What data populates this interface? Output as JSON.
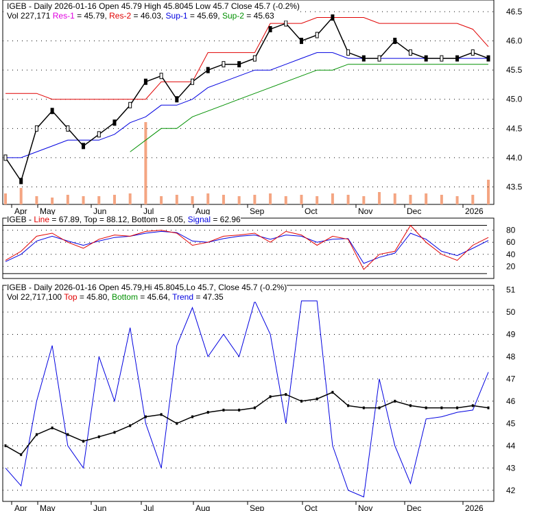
{
  "header1": {
    "line1": "IGEB - Daily 2026-01-16 Open 45.79  High 45.8045  Low 45.7  Close 45.7 (-0.2%)",
    "vol": "Vol 227,171",
    "res1": "Res-1",
    "res1_val": " = 45.79, ",
    "res2": "Res-2",
    "res2_val": " = 46.03, ",
    "sup1": "Sup-1",
    "sup1_val": " = 45.69, ",
    "sup2": "Sup-2",
    "sup2_val": " = 45.63"
  },
  "header2": {
    "prefix": "IGEB - ",
    "line": "Line",
    "line_val": " = 67.89, Top = 88.12, Bottom = 8.05, ",
    "signal": "Signal",
    "signal_val": " = 62.96"
  },
  "header3": {
    "line1": "IGEB - Daily 2026-01-16 Open 45.79,Hi 45.8045,Lo 45.7, Close 45.7 (-0.2%)",
    "vol": "Vol 22,717,100 ",
    "top": "Top",
    "top_val": " = 45.80, ",
    "bottom": "Bottom",
    "bottom_val": " = 45.64, ",
    "trend": "Trend",
    "trend_val": " = 47.35"
  },
  "colors": {
    "res1": "#e000e0",
    "res2": "#e00000",
    "sup1": "#0000e0",
    "sup2": "#009000",
    "volume": "#f4a582"
  },
  "chart_data": [
    {
      "type": "line",
      "title": "IGEB - Daily price with support/resistance",
      "ylim": [
        43.2,
        46.7
      ],
      "yticks": [
        "46.5",
        "46.0",
        "45.5",
        "45.0",
        "44.5",
        "44.0",
        "43.5"
      ],
      "months": [
        "Apr",
        "May",
        "Jun",
        "Jul",
        "Aug",
        "Sep",
        "Oct",
        "Nov",
        "Dec",
        "2026"
      ],
      "close": [
        44.0,
        43.6,
        44.5,
        44.8,
        44.5,
        44.2,
        44.4,
        44.6,
        44.9,
        45.3,
        45.4,
        45.0,
        45.3,
        45.5,
        45.6,
        45.6,
        45.7,
        46.2,
        46.3,
        46.0,
        46.1,
        46.4,
        45.8,
        45.7,
        45.7,
        46.0,
        45.8,
        45.7,
        45.7,
        45.7,
        45.8,
        45.7
      ],
      "volume": [
        40,
        60,
        30,
        25,
        35,
        30,
        30,
        35,
        40,
        300,
        30,
        35,
        30,
        40,
        35,
        30,
        35,
        40,
        30,
        35,
        30,
        40,
        35,
        30,
        45,
        40,
        35,
        40,
        35,
        30,
        35,
        90
      ],
      "res2": [
        45.1,
        45.1,
        45.1,
        45.0,
        45.0,
        45.0,
        45.0,
        45.0,
        45.0,
        45.0,
        45.3,
        45.3,
        45.3,
        45.8,
        45.8,
        45.8,
        45.8,
        46.3,
        46.3,
        46.3,
        46.4,
        46.4,
        46.4,
        46.4,
        46.3,
        46.3,
        46.3,
        46.3,
        46.3,
        46.3,
        46.2,
        45.9
      ],
      "sup2": [
        null,
        null,
        null,
        null,
        null,
        null,
        null,
        null,
        44.1,
        44.3,
        44.5,
        44.5,
        44.7,
        44.8,
        44.9,
        45.0,
        45.1,
        45.2,
        45.3,
        45.4,
        45.5,
        45.5,
        45.6,
        45.6,
        45.6,
        45.6,
        45.6,
        45.6,
        45.6,
        45.6,
        45.6,
        45.6
      ],
      "sup1": [
        44.0,
        44.0,
        44.1,
        44.2,
        44.3,
        44.3,
        44.3,
        44.4,
        44.6,
        44.7,
        44.9,
        44.9,
        45.0,
        45.2,
        45.3,
        45.4,
        45.5,
        45.5,
        45.6,
        45.7,
        45.8,
        45.8,
        45.7,
        45.7,
        45.7,
        45.7,
        45.7,
        45.7,
        45.7,
        45.7,
        45.7,
        45.7
      ]
    },
    {
      "type": "line",
      "title": "Oscillator",
      "ylim": [
        0,
        100
      ],
      "yticks": [
        "80",
        "60",
        "40",
        "20"
      ],
      "top": 88.12,
      "bottom": 8.05,
      "line": [
        30,
        45,
        70,
        75,
        60,
        50,
        65,
        72,
        70,
        78,
        80,
        75,
        55,
        60,
        70,
        72,
        75,
        60,
        78,
        72,
        55,
        70,
        65,
        15,
        40,
        45,
        88,
        60,
        40,
        30,
        55,
        68
      ],
      "signal": [
        28,
        40,
        62,
        70,
        62,
        55,
        62,
        68,
        70,
        75,
        78,
        76,
        62,
        60,
        66,
        70,
        72,
        65,
        72,
        70,
        60,
        65,
        66,
        25,
        35,
        42,
        75,
        65,
        45,
        38,
        50,
        63
      ]
    },
    {
      "type": "line",
      "title": "Trend",
      "ylim": [
        41.5,
        51.2
      ],
      "yticks": [
        "51",
        "50",
        "49",
        "48",
        "47",
        "46",
        "45",
        "44",
        "43",
        "42"
      ],
      "months": [
        "Apr",
        "May",
        "Jun",
        "Jul",
        "Aug",
        "Sep",
        "Oct",
        "Nov",
        "Dec",
        "2026"
      ],
      "close": [
        44.0,
        43.6,
        44.5,
        44.8,
        44.5,
        44.2,
        44.4,
        44.6,
        44.9,
        45.3,
        45.4,
        45.0,
        45.3,
        45.5,
        45.6,
        45.6,
        45.7,
        46.2,
        46.3,
        46.0,
        46.1,
        46.4,
        45.8,
        45.7,
        45.7,
        46.0,
        45.8,
        45.7,
        45.7,
        45.7,
        45.8,
        45.7
      ],
      "trend": [
        43,
        42.2,
        46,
        48.5,
        44,
        43,
        48,
        46,
        49.3,
        45,
        43,
        48.5,
        50.2,
        48,
        49,
        48,
        50.5,
        49,
        45,
        50.5,
        50.5,
        44,
        42,
        41.7,
        47,
        44,
        42.3,
        45.2,
        45.3,
        45.5,
        45.6,
        47.3
      ]
    }
  ]
}
